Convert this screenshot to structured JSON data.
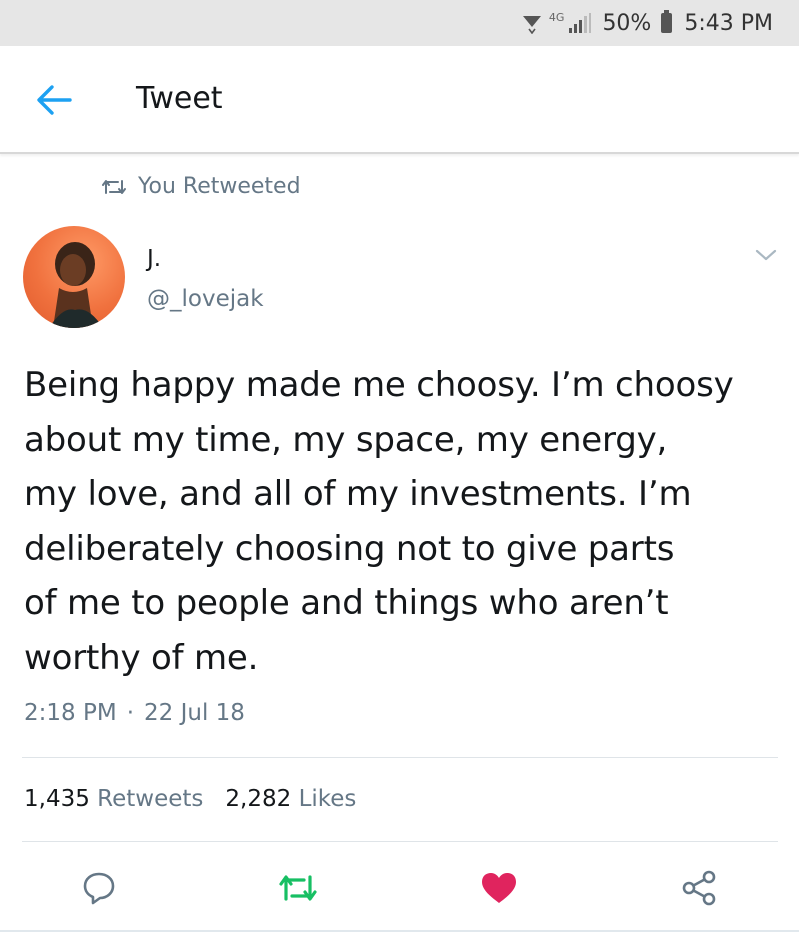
{
  "status_bar": {
    "network": "4G",
    "battery": "50%",
    "time": "5:43 PM"
  },
  "header": {
    "title": "Tweet",
    "back_icon": "arrow-left-icon"
  },
  "retweet_context": {
    "label": "You Retweeted",
    "icon": "retweet-icon"
  },
  "tweet": {
    "author_name": "J.",
    "author_handle": "@_lovejak",
    "text": "Being happy made me choosy. I’m choosy\nabout my time, my space, my energy,\nmy love, and all of my investments. I’m\ndeliberately choosing not to give parts\nof me to people and things who aren’t\nworthy of me.",
    "time": "2:18 PM",
    "separator": "·",
    "date": "22 Jul 18",
    "retweet_count": "1,435",
    "retweet_label": "Retweets",
    "like_count": "2,282",
    "like_label": "Likes"
  },
  "actions": {
    "reply_icon": "reply-icon",
    "retweet_icon": "retweet-icon",
    "like_icon": "heart-icon",
    "share_icon": "share-icon"
  },
  "colors": {
    "accent": "#1da1f2",
    "retweeted": "#17bf63",
    "liked": "#e0245e",
    "secondary_text": "#657786",
    "status_bar_bg": "#e6e6e6"
  }
}
